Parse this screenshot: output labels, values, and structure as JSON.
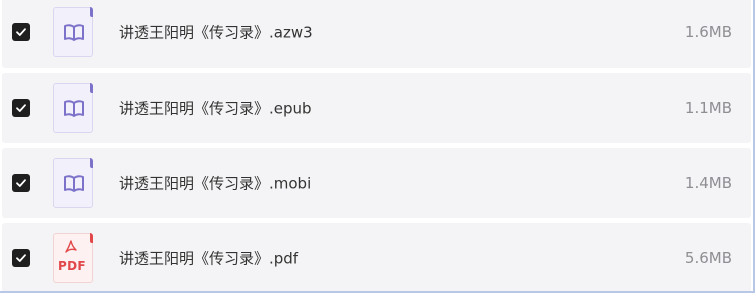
{
  "files": [
    {
      "name": "讲透王阳明《传习录》.azw3",
      "size": "1.6MB",
      "icon": "book-icon",
      "checked": true
    },
    {
      "name": "讲透王阳明《传习录》.epub",
      "size": "1.1MB",
      "icon": "book-icon",
      "checked": true
    },
    {
      "name": "讲透王阳明《传习录》.mobi",
      "size": "1.4MB",
      "icon": "book-icon",
      "checked": true
    },
    {
      "name": "讲透王阳明《传习录》.pdf",
      "size": "5.6MB",
      "icon": "pdf-icon",
      "checked": true,
      "icon_label": "PDF"
    }
  ],
  "colors": {
    "book_accent": "#7c72c9",
    "pdf_accent": "#e2484a",
    "checkbox": "#1f1f1f"
  }
}
